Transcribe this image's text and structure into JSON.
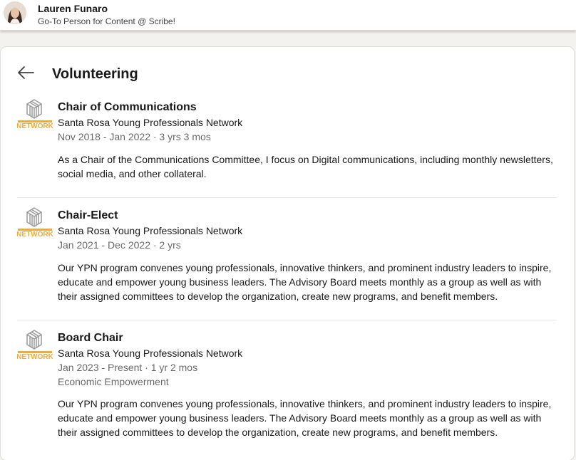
{
  "profile": {
    "name": "Lauren Funaro",
    "headline": "Go-To Person for Content @ Scribe!"
  },
  "page": {
    "title": "Volunteering",
    "back_icon": "arrow-left-icon"
  },
  "colors": {
    "logo_gray": "#9a9a9a",
    "logo_orange": "#f2a93b"
  },
  "entries": [
    {
      "role": "Chair of Communications",
      "org": "Santa Rosa Young Professionals Network",
      "dates": "Nov 2018 - Jan 2022 · 3 yrs 3 mos",
      "description": "As a Chair of the Communications Committee, I focus on Digital communications, including monthly newsletters, social media, and other collateral."
    },
    {
      "role": "Chair-Elect",
      "org": "Santa Rosa Young Professionals Network",
      "dates": "Jan 2021 - Dec 2022 · 2 yrs",
      "description": "Our YPN program convenes young professionals, innovative thinkers, and prominent industry leaders to inspire, educate and empower young business leaders. The Advisory Board meets monthly as a group as well as with their assigned committees to develop the organization, create new programs, and benefit members."
    },
    {
      "role": "Board Chair",
      "org": "Santa Rosa Young Professionals Network",
      "dates": "Jan 2023 - Present · 1 yr 2 mos",
      "cause": "Economic Empowerment",
      "description": "Our YPN program convenes young professionals, innovative thinkers, and prominent industry leaders to inspire, educate and empower young business leaders. The Advisory Board meets monthly as a group as well as with their assigned committees to develop the organization, create new programs, and benefit members."
    }
  ]
}
